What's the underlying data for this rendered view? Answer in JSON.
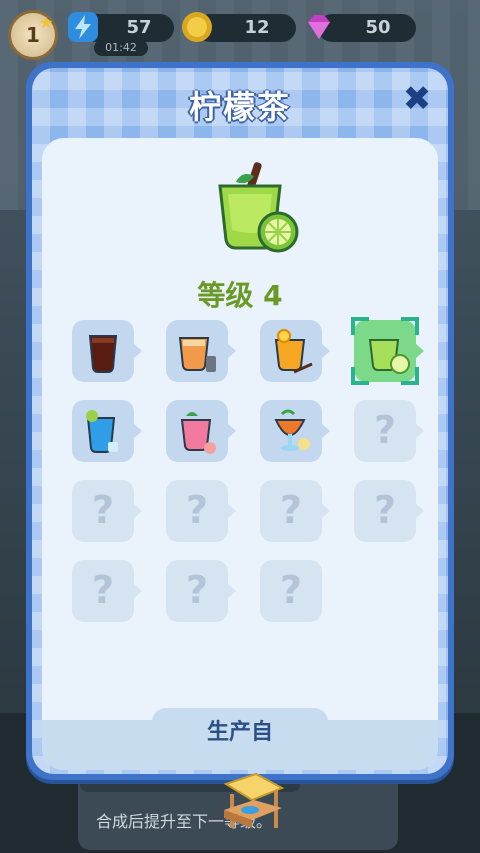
{
  "hud": {
    "level": "1",
    "energy": "57",
    "timer": "01:42",
    "coins": "12",
    "gems": "50"
  },
  "modal": {
    "title": "柠檬茶",
    "level_text": "等级 4",
    "source_label": "生产自",
    "unknown_mark": "?"
  },
  "grid": {
    "items": [
      {
        "kind": "cola-glass-icon",
        "state": "unlocked"
      },
      {
        "kind": "iced-tea-glass-icon",
        "state": "unlocked"
      },
      {
        "kind": "orange-juice-glass-icon",
        "state": "unlocked"
      },
      {
        "kind": "lime-tea-glass-icon",
        "state": "current"
      },
      {
        "kind": "blue-drink-icon",
        "state": "unlocked"
      },
      {
        "kind": "pink-smoothie-icon",
        "state": "unlocked"
      },
      {
        "kind": "tropical-cocktail-icon",
        "state": "unlocked"
      },
      {
        "kind": "question-mark-icon",
        "state": "unknown"
      },
      {
        "kind": "question-mark-icon",
        "state": "unknown"
      },
      {
        "kind": "question-mark-icon",
        "state": "unknown"
      },
      {
        "kind": "question-mark-icon",
        "state": "unknown"
      },
      {
        "kind": "question-mark-icon",
        "state": "unknown"
      },
      {
        "kind": "question-mark-icon",
        "state": "unknown"
      },
      {
        "kind": "question-mark-icon",
        "state": "unknown"
      },
      {
        "kind": "question-mark-icon",
        "state": "unknown"
      }
    ]
  },
  "background": {
    "tip": "合成后提升至下一等级。"
  },
  "colors": {
    "modal_border": "#3f73c9",
    "panel": "#eaf3fc",
    "level_green": "#6a9a25",
    "current_cell": "#7dd98a",
    "title_outline": "#3b62a8"
  }
}
